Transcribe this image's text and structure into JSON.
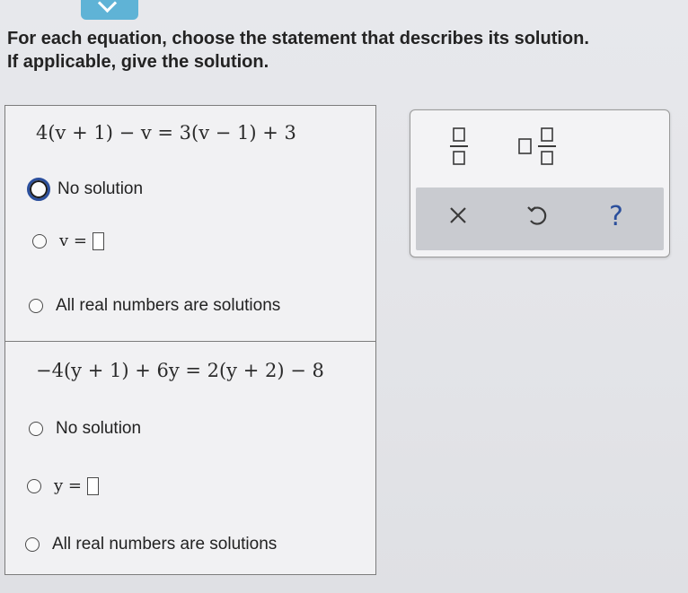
{
  "prompt": {
    "line1": "For each equation, choose the statement that describes its solution.",
    "line2": "If applicable, give the solution."
  },
  "problems": [
    {
      "equation": "4(v + 1) − v = 3(v − 1) + 3",
      "variable_label": "v =",
      "options": {
        "no_solution": "No solution",
        "all_real": "All real numbers are solutions"
      },
      "selected": "no_solution"
    },
    {
      "equation": "−4(y + 1) + 6y = 2(y + 2) − 8",
      "variable_label": "y =",
      "options": {
        "no_solution": "No solution",
        "all_real": "All real numbers are solutions"
      },
      "selected": null
    }
  ],
  "toolbar": {
    "help_label": "?",
    "icons": [
      "fraction-icon",
      "mixed-number-icon",
      "clear-icon",
      "undo-icon",
      "help-icon"
    ]
  },
  "colors": {
    "accent_blue": "#2b4f9c",
    "tab_blue": "#5fb3d6",
    "toolbar_bottom": "#c9cbd0"
  }
}
